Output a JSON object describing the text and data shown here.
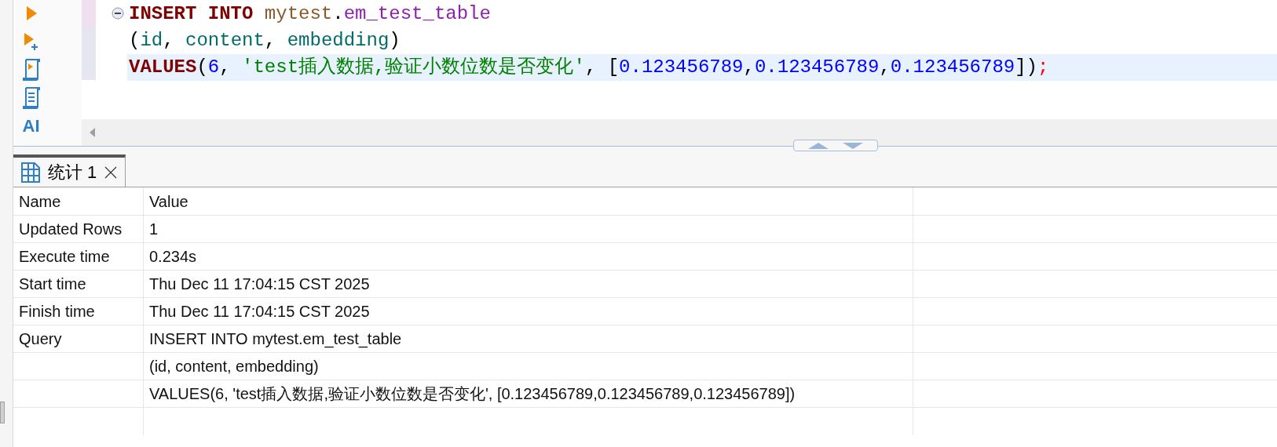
{
  "editor": {
    "lines": [
      {
        "current": false,
        "foldable": true,
        "tokens": [
          {
            "kind": "keyword",
            "text": "INSERT INTO "
          },
          {
            "kind": "schema",
            "text": "mytest"
          },
          {
            "kind": "punct",
            "text": "."
          },
          {
            "kind": "table",
            "text": "em_test_table"
          }
        ]
      },
      {
        "current": false,
        "foldable": false,
        "tokens": [
          {
            "kind": "punct",
            "text": "("
          },
          {
            "kind": "column",
            "text": "id"
          },
          {
            "kind": "punct",
            "text": ", "
          },
          {
            "kind": "column",
            "text": "content"
          },
          {
            "kind": "punct",
            "text": ", "
          },
          {
            "kind": "column",
            "text": "embedding"
          },
          {
            "kind": "punct",
            "text": ")"
          }
        ]
      },
      {
        "current": true,
        "foldable": false,
        "tokens": [
          {
            "kind": "keyword",
            "text": "VALUES"
          },
          {
            "kind": "punct",
            "text": "("
          },
          {
            "kind": "number",
            "text": "6"
          },
          {
            "kind": "punct",
            "text": ", "
          },
          {
            "kind": "string",
            "text": "'test插入数据,验证小数位数是否变化'"
          },
          {
            "kind": "punct",
            "text": ", ["
          },
          {
            "kind": "number",
            "text": "0.123456789"
          },
          {
            "kind": "punct",
            "text": ","
          },
          {
            "kind": "number",
            "text": "0.123456789"
          },
          {
            "kind": "punct",
            "text": ","
          },
          {
            "kind": "number",
            "text": "0.123456789"
          },
          {
            "kind": "punct",
            "text": "])"
          },
          {
            "kind": "error",
            "text": ";"
          }
        ]
      }
    ]
  },
  "toolbar": {
    "ai_label": "AI"
  },
  "tabs": [
    {
      "label": "统计 1",
      "selected": true
    }
  ],
  "table": {
    "columns": [
      "Name",
      "Value"
    ],
    "rows": [
      [
        "Updated Rows",
        "1"
      ],
      [
        "Execute time",
        "0.234s"
      ],
      [
        "Start time",
        "Thu Dec 11 17:04:15 CST 2025"
      ],
      [
        "Finish time",
        "Thu Dec 11 17:04:15 CST 2025"
      ],
      [
        "Query",
        "INSERT INTO mytest.em_test_table"
      ],
      [
        "",
        "(id, content, embedding)"
      ],
      [
        "",
        "VALUES(6, 'test插入数据,验证小数位数是否变化', [0.123456789,0.123456789,0.123456789])"
      ]
    ]
  }
}
